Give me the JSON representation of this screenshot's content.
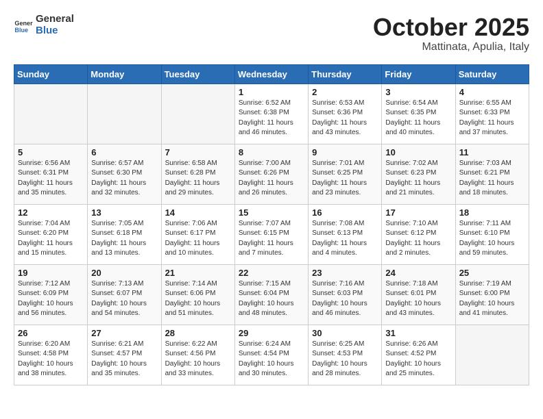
{
  "header": {
    "logo_line1": "General",
    "logo_line2": "Blue",
    "month": "October 2025",
    "location": "Mattinata, Apulia, Italy"
  },
  "weekdays": [
    "Sunday",
    "Monday",
    "Tuesday",
    "Wednesday",
    "Thursday",
    "Friday",
    "Saturday"
  ],
  "weeks": [
    [
      {
        "day": "",
        "info": ""
      },
      {
        "day": "",
        "info": ""
      },
      {
        "day": "",
        "info": ""
      },
      {
        "day": "1",
        "info": "Sunrise: 6:52 AM\nSunset: 6:38 PM\nDaylight: 11 hours\nand 46 minutes."
      },
      {
        "day": "2",
        "info": "Sunrise: 6:53 AM\nSunset: 6:36 PM\nDaylight: 11 hours\nand 43 minutes."
      },
      {
        "day": "3",
        "info": "Sunrise: 6:54 AM\nSunset: 6:35 PM\nDaylight: 11 hours\nand 40 minutes."
      },
      {
        "day": "4",
        "info": "Sunrise: 6:55 AM\nSunset: 6:33 PM\nDaylight: 11 hours\nand 37 minutes."
      }
    ],
    [
      {
        "day": "5",
        "info": "Sunrise: 6:56 AM\nSunset: 6:31 PM\nDaylight: 11 hours\nand 35 minutes."
      },
      {
        "day": "6",
        "info": "Sunrise: 6:57 AM\nSunset: 6:30 PM\nDaylight: 11 hours\nand 32 minutes."
      },
      {
        "day": "7",
        "info": "Sunrise: 6:58 AM\nSunset: 6:28 PM\nDaylight: 11 hours\nand 29 minutes."
      },
      {
        "day": "8",
        "info": "Sunrise: 7:00 AM\nSunset: 6:26 PM\nDaylight: 11 hours\nand 26 minutes."
      },
      {
        "day": "9",
        "info": "Sunrise: 7:01 AM\nSunset: 6:25 PM\nDaylight: 11 hours\nand 23 minutes."
      },
      {
        "day": "10",
        "info": "Sunrise: 7:02 AM\nSunset: 6:23 PM\nDaylight: 11 hours\nand 21 minutes."
      },
      {
        "day": "11",
        "info": "Sunrise: 7:03 AM\nSunset: 6:21 PM\nDaylight: 11 hours\nand 18 minutes."
      }
    ],
    [
      {
        "day": "12",
        "info": "Sunrise: 7:04 AM\nSunset: 6:20 PM\nDaylight: 11 hours\nand 15 minutes."
      },
      {
        "day": "13",
        "info": "Sunrise: 7:05 AM\nSunset: 6:18 PM\nDaylight: 11 hours\nand 13 minutes."
      },
      {
        "day": "14",
        "info": "Sunrise: 7:06 AM\nSunset: 6:17 PM\nDaylight: 11 hours\nand 10 minutes."
      },
      {
        "day": "15",
        "info": "Sunrise: 7:07 AM\nSunset: 6:15 PM\nDaylight: 11 hours\nand 7 minutes."
      },
      {
        "day": "16",
        "info": "Sunrise: 7:08 AM\nSunset: 6:13 PM\nDaylight: 11 hours\nand 4 minutes."
      },
      {
        "day": "17",
        "info": "Sunrise: 7:10 AM\nSunset: 6:12 PM\nDaylight: 11 hours\nand 2 minutes."
      },
      {
        "day": "18",
        "info": "Sunrise: 7:11 AM\nSunset: 6:10 PM\nDaylight: 10 hours\nand 59 minutes."
      }
    ],
    [
      {
        "day": "19",
        "info": "Sunrise: 7:12 AM\nSunset: 6:09 PM\nDaylight: 10 hours\nand 56 minutes."
      },
      {
        "day": "20",
        "info": "Sunrise: 7:13 AM\nSunset: 6:07 PM\nDaylight: 10 hours\nand 54 minutes."
      },
      {
        "day": "21",
        "info": "Sunrise: 7:14 AM\nSunset: 6:06 PM\nDaylight: 10 hours\nand 51 minutes."
      },
      {
        "day": "22",
        "info": "Sunrise: 7:15 AM\nSunset: 6:04 PM\nDaylight: 10 hours\nand 48 minutes."
      },
      {
        "day": "23",
        "info": "Sunrise: 7:16 AM\nSunset: 6:03 PM\nDaylight: 10 hours\nand 46 minutes."
      },
      {
        "day": "24",
        "info": "Sunrise: 7:18 AM\nSunset: 6:01 PM\nDaylight: 10 hours\nand 43 minutes."
      },
      {
        "day": "25",
        "info": "Sunrise: 7:19 AM\nSunset: 6:00 PM\nDaylight: 10 hours\nand 41 minutes."
      }
    ],
    [
      {
        "day": "26",
        "info": "Sunrise: 6:20 AM\nSunset: 4:58 PM\nDaylight: 10 hours\nand 38 minutes."
      },
      {
        "day": "27",
        "info": "Sunrise: 6:21 AM\nSunset: 4:57 PM\nDaylight: 10 hours\nand 35 minutes."
      },
      {
        "day": "28",
        "info": "Sunrise: 6:22 AM\nSunset: 4:56 PM\nDaylight: 10 hours\nand 33 minutes."
      },
      {
        "day": "29",
        "info": "Sunrise: 6:24 AM\nSunset: 4:54 PM\nDaylight: 10 hours\nand 30 minutes."
      },
      {
        "day": "30",
        "info": "Sunrise: 6:25 AM\nSunset: 4:53 PM\nDaylight: 10 hours\nand 28 minutes."
      },
      {
        "day": "31",
        "info": "Sunrise: 6:26 AM\nSunset: 4:52 PM\nDaylight: 10 hours\nand 25 minutes."
      },
      {
        "day": "",
        "info": ""
      }
    ]
  ]
}
